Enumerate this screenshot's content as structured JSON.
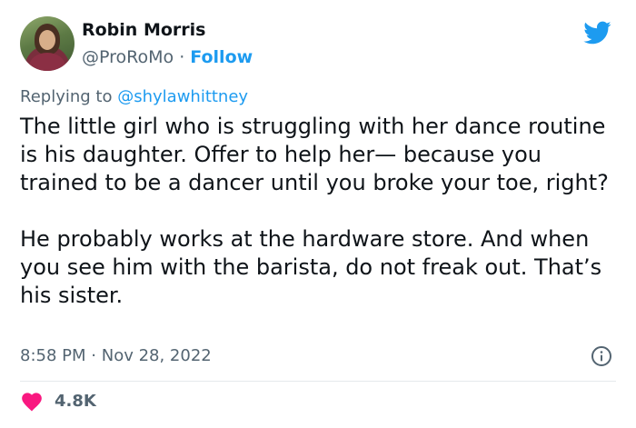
{
  "author": {
    "name": "Robin Morris",
    "handle": "@ProRoMo",
    "separator": "·",
    "follow_label": "Follow"
  },
  "reply": {
    "prefix": "Replying to",
    "mention": "@shylawhittney"
  },
  "tweet": {
    "paragraph1": "The little girl who is struggling with her dance routine is his daughter. Offer to help her— because you trained to be a dancer until you broke your toe, right?",
    "paragraph2": "He probably works at the hardware store. And when you see him with the barista, do not freak out. That’s his sister."
  },
  "meta": {
    "time": "8:58 PM",
    "separator": "·",
    "date": "Nov 28, 2022"
  },
  "engagement": {
    "likes": "4.8K"
  },
  "colors": {
    "accent": "#1d9bf0",
    "like": "#f91880",
    "secondary_text": "#536471"
  },
  "icons": [
    "twitter-bird-icon",
    "info-icon",
    "heart-icon"
  ]
}
